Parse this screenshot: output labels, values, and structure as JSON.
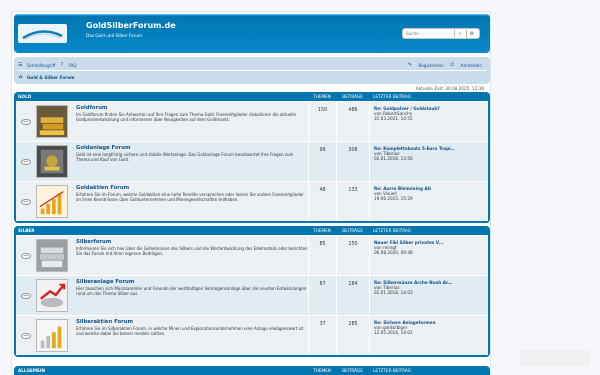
{
  "header": {
    "title": "GoldSilberForum.de",
    "description": "Das Gold und Silber Forum",
    "search_placeholder": "Suche ...",
    "search_button": "search-icon",
    "adv_search_button": "gear-icon"
  },
  "nav": {
    "quicklinks": "Schnellzugriff",
    "faq": "FAQ",
    "register": "Registrieren",
    "login": "Anmelden",
    "breadcrumb": "Gold & Silber Forum"
  },
  "current_time": "Aktuelle Zeit: 30.08.2025, 12:36",
  "colors": {
    "header": "#12a3eb",
    "nav": "#cadceb",
    "row": "#ecf0f3",
    "row_alt": "#e1ebf2",
    "link": "#105289",
    "forum_head": "#0076b1"
  },
  "sections": [
    {
      "name": "GOLD",
      "col_topics": "THEMEN",
      "col_posts": "BEITRÄGE",
      "col_last": "LETZTER BEITRAG",
      "forums": [
        {
          "title": "Goldforum",
          "desc": "Im Goldforum finden Sie Antworten auf Ihre Fragen zum Thema Gold. Forenmitglieder diskutieren die aktuelle Goldpreisentwicklung und informieren über Neuigkeiten auf dem Goldmarkt.",
          "topics": "150",
          "posts": "486",
          "last_title": "Re: Goldpalver / Goldstaub?",
          "last_by": "von RobertSanchs",
          "last_date": "31.03.2021, 14:55"
        },
        {
          "title": "Goldanlage Forum",
          "desc": "Gold ist eine langfristig sichere und stabile Wertanlage. Das Goldanlage Forum beantwortet Ihre Fragen zum Thema und Kauf von Gold.",
          "topics": "99",
          "posts": "308",
          "last_title": "Re: Komplettabsatz 5-Euro Tropi…",
          "last_by": "von Tiberius",
          "last_date": "02.01.2018, 13:56"
        },
        {
          "title": "Goldaktien Forum",
          "desc": "Erfahren Sie im Forum, welche Goldaktien eine hohe Rendite versprechen oder lassen Sie andere Forenmitglieder an ihren Kenntnissen über Goldunternehmen und Minengesellschaften teilhaben.",
          "topics": "48",
          "posts": "133",
          "last_title": "Re: Aurro Bleimining AG",
          "last_by": "von Visuell",
          "last_date": "19.06.2015, 15:29"
        }
      ]
    },
    {
      "name": "SILBER",
      "col_topics": "THEMEN",
      "col_posts": "BEITRÄGE",
      "col_last": "LETZTER BEITRAG",
      "forums": [
        {
          "title": "Silberforum",
          "desc": "Informieren Sie sich hier über die Geheimnisse des Silbers und die Wertentwicklung des Edelmetalls oder berichten Sie das Forum mit Ihren eigenen Beiträgen.",
          "topics": "85",
          "posts": "250",
          "last_title": "Neuer Fiki Silber privates V…",
          "last_by": "von reinigt",
          "last_date": "06.08.2020, 09:48"
        },
        {
          "title": "Silberanlage Forum",
          "desc": "Hier tauschen sich Münzsammler und Freunde der werthaltigen Vermögensanlage über die neusten Entwicklungen rund um das Thema Silber aus.",
          "topics": "67",
          "posts": "184",
          "last_title": "Re: Silbermünze Arche Noah Ar…",
          "last_by": "von Tiberius",
          "last_date": "02.01.2018, 14:03"
        },
        {
          "title": "Silberaktien Forum",
          "desc": "Erfahren Sie im Silberaktien Forum, in welche Minen und Explorationsunternehmen eine Anlage erwägenswert ist und welche dabei Sie besser meiden sollten.",
          "topics": "37",
          "posts": "285",
          "last_title": "Re: Sichere Anlageformen",
          "last_by": "von goldsilbiger",
          "last_date": "12.05.2014, 14:02"
        }
      ]
    },
    {
      "name": "ALLGEMEIN",
      "col_topics": "THEMEN",
      "col_posts": "BEITRÄGE",
      "col_last": "LETZTER BEITRAG",
      "forums": []
    }
  ]
}
